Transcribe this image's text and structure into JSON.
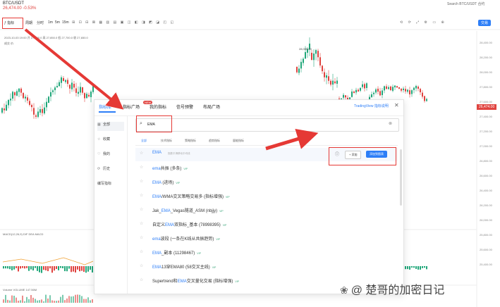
{
  "header": {
    "pair": "BTC/USDT",
    "change": "26,474.00 -0.53%",
    "search_placeholder": "Search BTC/USDT 合约"
  },
  "toolbar": {
    "indicator_label": "指标",
    "items": [
      "周期",
      "分时",
      "1m",
      "5m",
      "15m"
    ],
    "icon_row": "⊞ ⊡ ⊟ ⊠ ▦ ▥ ▤ ▣ ◫ ◧ ◨ ◩ ◪ ◰ ◱",
    "right_icons": "⟲ ⟳ ⤢ ⚙ ▭ ⊕",
    "pill_label": "交易"
  },
  "chart": {
    "ohlc_line1": "2023-10-03 19:00 开 27,800.0 高 27,850.0 低 27,700.0 收 27,650.0",
    "ohlc_line2": "成交 价",
    "high_label": "28,000.00",
    "price_ticks": [
      "28,400.00",
      "28,200.00",
      "28,000.00",
      "27,800.00",
      "27,600.00",
      "27,400.00",
      "27,200.00",
      "27,000.00",
      "26,800.00",
      "26,600.00",
      "26,400.00",
      "26,200.00",
      "26,000.00",
      "25,800.00",
      "25,600.00",
      "25,400.00"
    ],
    "price_tag": "26,474.00",
    "sub_label1": "MACD(12,26,9) DIF DEA MACD",
    "sub_label2": "Volume VOLUME 147.56M"
  },
  "dialog": {
    "tabs": [
      "指标库",
      "指标广场",
      "我的指标",
      "信号预警",
      "布局广场"
    ],
    "tab_badge": "NEW",
    "link": "TradingView 指标说明",
    "close": "✕",
    "nav": [
      {
        "icon": "▦",
        "label": "全部"
      },
      {
        "icon": "☆",
        "label": "收藏"
      },
      {
        "icon": "♡",
        "label": "我的"
      },
      {
        "icon": "⟳",
        "label": "历史"
      },
      {
        "icon": "",
        "label": "编写指标"
      }
    ],
    "search_value": "EMA",
    "filters": [
      "全部",
      "技术指标",
      "策略指标",
      "趋势指标",
      "量能指标"
    ],
    "results": [
      {
        "name_pre": "",
        "hi": "EMA",
        "name_post": "",
        "sub": "指数平滑移动平均线",
        "tag": ""
      },
      {
        "name_pre": "",
        "hi": "ema",
        "name_post": "共振 (多条)",
        "sub": "",
        "tag": "VIP"
      },
      {
        "name_pre": "",
        "hi": "EMA",
        "name_post": " (进场)",
        "sub": "",
        "tag": "VIP"
      },
      {
        "name_pre": "",
        "hi": "EMA",
        "name_post": "/WMA交叉策略交易多 (指标增强)",
        "sub": "",
        "tag": "VIP"
      },
      {
        "name_pre": "Jak_",
        "hi": "EMA",
        "name_post": "_Vegas隧道_ASM (nbjjy)",
        "sub": "",
        "tag": "VIP"
      },
      {
        "name_pre": "自定义",
        "hi": "EMA",
        "name_post": "双指标_基本 (78998395)",
        "sub": "",
        "tag": "VIP"
      },
      {
        "name_pre": "",
        "hi": "ema",
        "name_post": "波段 (一条在K线从共振趋势)",
        "sub": "",
        "tag": "VIP"
      },
      {
        "name_pre": "",
        "hi": "EMA",
        "name_post": "_副本 (11298467)",
        "sub": "",
        "tag": "VIP"
      },
      {
        "name_pre": "",
        "hi": "EMA",
        "name_post": "13穿EMA80 (58交叉主线)",
        "sub": "",
        "tag": "VIP"
      },
      {
        "name_pre": "Supertrend和",
        "hi": "EMA",
        "name_post": "交叉量化交易 (指标增强)",
        "sub": "",
        "tag": "VIP"
      }
    ],
    "actions": {
      "info": "ⓘ",
      "add": "+ 添加",
      "main": "添加到图表"
    }
  },
  "watermark": {
    "icon": "❀",
    "text": "@ 楚哥的加密日记"
  },
  "colors": {
    "accent": "#2d7ef7",
    "highlight": "#e53935",
    "up": "#21a77a",
    "down": "#e0433f"
  }
}
